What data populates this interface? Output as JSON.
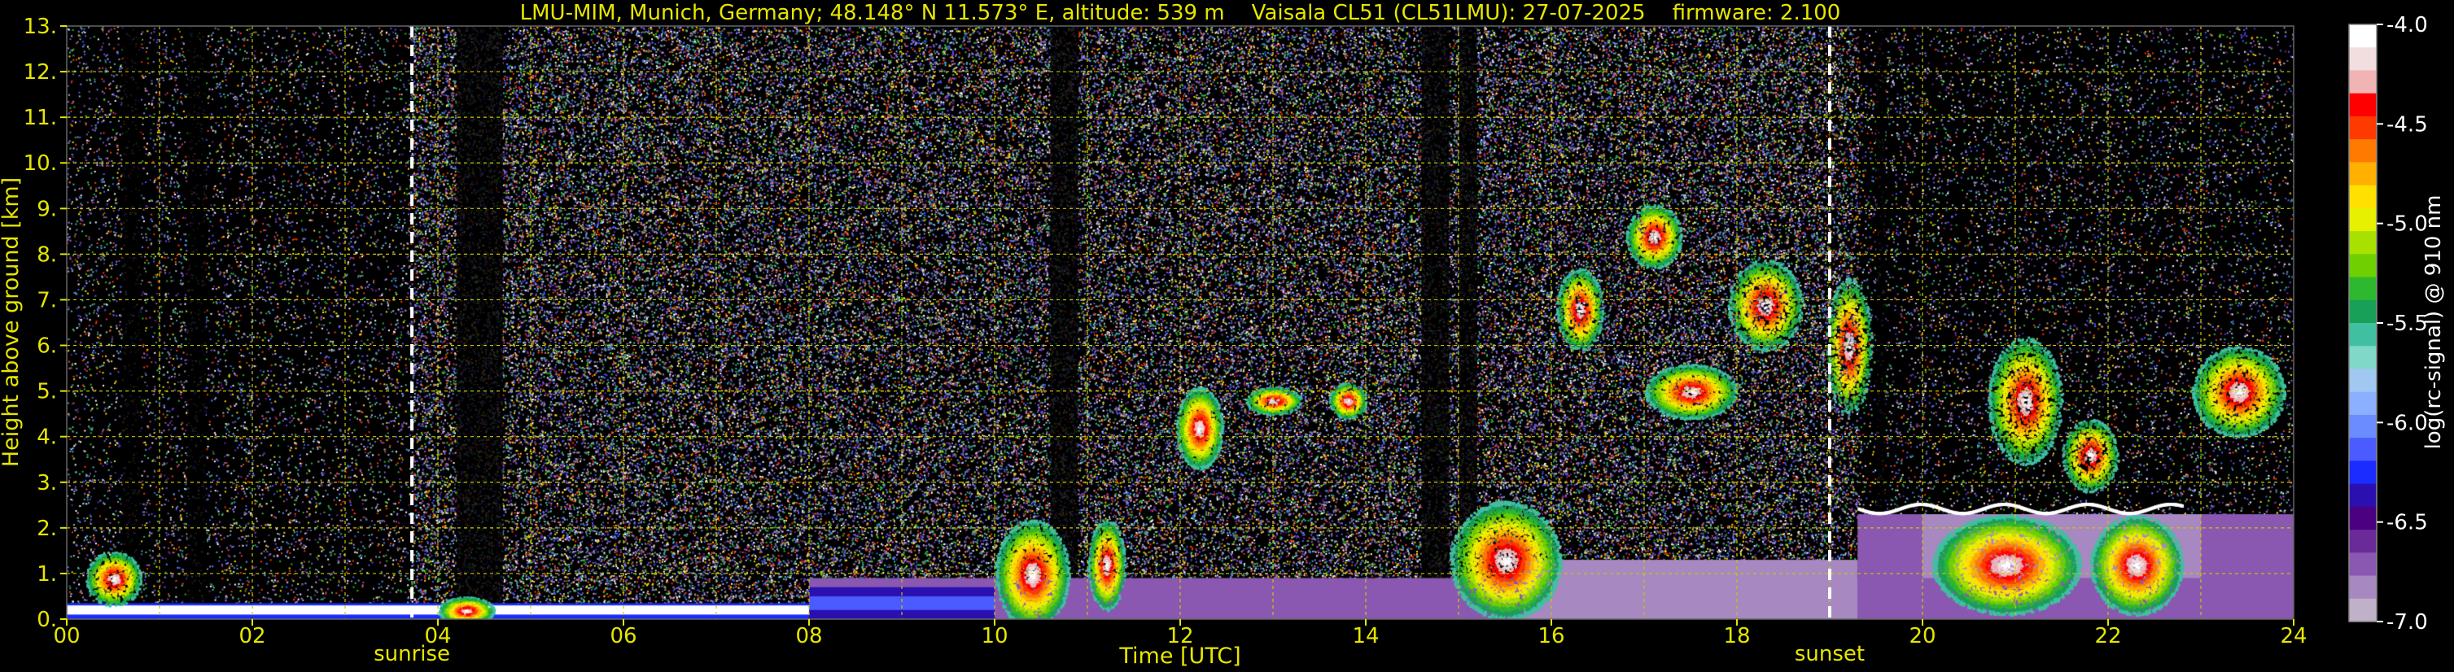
{
  "chart_data": {
    "type": "heatmap",
    "title": "LMU-MIM, Munich, Germany; 48.148° N 11.573° E, altitude: 539 m    Vaisala CL51 (CL51LMU): 27-07-2025    firmware: 2.100",
    "xlabel": "Time [UTC]",
    "ylabel": "Height above ground [km]",
    "xlim": [
      0,
      24
    ],
    "ylim": [
      0,
      13
    ],
    "x_ticks": [
      "00",
      "02",
      "04",
      "06",
      "08",
      "10",
      "12",
      "14",
      "16",
      "18",
      "20",
      "22",
      "24"
    ],
    "y_ticks": [
      "0.",
      "1.",
      "2.",
      "3.",
      "4.",
      "5.",
      "6.",
      "7.",
      "8.",
      "9.",
      "10.",
      "11.",
      "12.",
      "13."
    ],
    "grid": true,
    "markers": [
      {
        "label": "sunrise",
        "time": 3.72
      },
      {
        "label": "sunset",
        "time": 19.0
      }
    ],
    "colorbar": {
      "label": "log(rc-signal) @ 910 nm",
      "range": [
        -7.0,
        -4.0
      ],
      "ticks": [
        "-4.0",
        "-4.5",
        "-5.0",
        "-5.5",
        "-6.0",
        "-6.5",
        "-7.0"
      ],
      "colors": [
        "#ffffff",
        "#f2dede",
        "#f0b4b4",
        "#ff0000",
        "#ff3a00",
        "#ff7a00",
        "#ffb000",
        "#ffe000",
        "#e6f000",
        "#a8e000",
        "#6ed000",
        "#2eb82e",
        "#18a058",
        "#40c0a0",
        "#80d8c8",
        "#a0c8f0",
        "#8ab0ff",
        "#6a8cff",
        "#4a5cff",
        "#1a2cff",
        "#2a10b0",
        "#4a0080",
        "#6a2a98",
        "#8a58b0",
        "#a888c0",
        "#c0b0c8"
      ]
    },
    "features": [
      {
        "name": "boundary-layer",
        "time_range": [
          0,
          24
        ],
        "height_range": [
          0,
          1.5
        ]
      },
      {
        "name": "residual-layer-top",
        "time_range": [
          19.3,
          22.8
        ],
        "height_km": 2.4
      },
      {
        "name": "elevated-cloud",
        "time_range": [
          16.2,
          19.5
        ],
        "height_range": [
          4.0,
          9.5
        ]
      },
      {
        "name": "elevated-cloud",
        "time_range": [
          12.0,
          14.0
        ],
        "height_range": [
          3.5,
          5.5
        ]
      },
      {
        "name": "elevated-cloud",
        "time_range": [
          20.5,
          22.0
        ],
        "height_range": [
          3.0,
          6.0
        ]
      },
      {
        "name": "elevated-cloud",
        "time_range": [
          23.0,
          24.0
        ],
        "height_range": [
          3.0,
          6.0
        ]
      }
    ]
  }
}
